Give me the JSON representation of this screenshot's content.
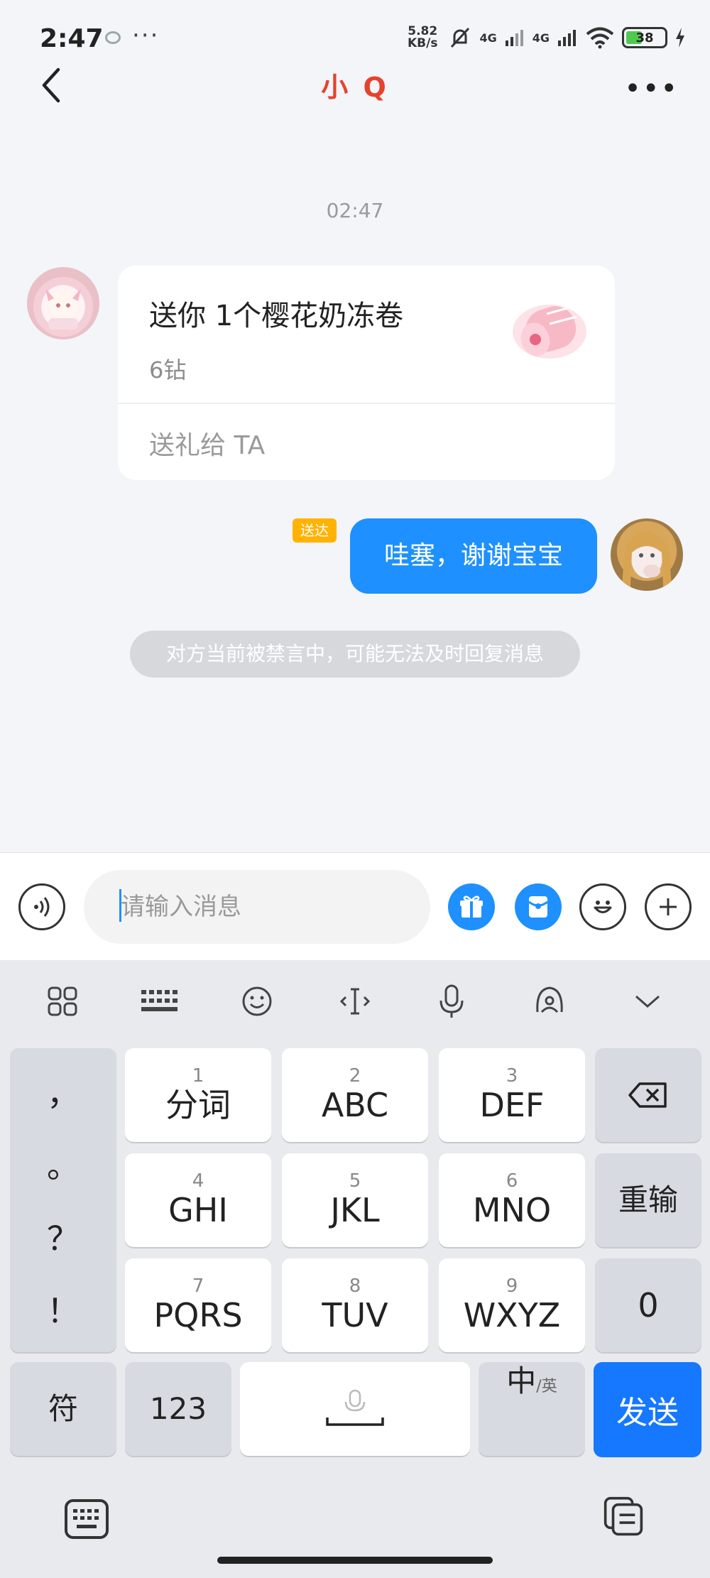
{
  "status_bar": {
    "time": "2:47",
    "dots": "···",
    "speed_value": "5.82",
    "speed_unit": "KB/s",
    "net1": "4G",
    "net2": "4G",
    "battery": "38"
  },
  "header": {
    "title": "小 Q",
    "more": "•••"
  },
  "chat": {
    "timestamp": "02:47",
    "gift_card": {
      "title": "送你 1个樱花奶冻卷",
      "price": "6钻",
      "action": "送礼给 TA"
    },
    "outgoing": {
      "tag": "送达",
      "text": "哇塞，谢谢宝宝"
    },
    "system_note": "对方当前被禁言中，可能无法及时回复消息"
  },
  "input_bar": {
    "placeholder": "请输入消息"
  },
  "keyboard": {
    "punctuation": [
      "，",
      "。",
      "？",
      "！"
    ],
    "keys": [
      {
        "num": "1",
        "label": "分词"
      },
      {
        "num": "2",
        "label": "ABC"
      },
      {
        "num": "3",
        "label": "DEF"
      },
      {
        "num": "4",
        "label": "GHI"
      },
      {
        "num": "5",
        "label": "JKL"
      },
      {
        "num": "6",
        "label": "MNO"
      },
      {
        "num": "7",
        "label": "PQRS"
      },
      {
        "num": "8",
        "label": "TUV"
      },
      {
        "num": "9",
        "label": "WXYZ"
      }
    ],
    "reenter": "重输",
    "zero": "0",
    "symbols": "符",
    "num_mode": "123",
    "lang_main": "中",
    "lang_sub": "/英",
    "send": "发送"
  },
  "colors": {
    "accent": "#1e90ff",
    "title": "#e5432d",
    "send_key": "#1677ff",
    "tag": "#ffb300"
  }
}
